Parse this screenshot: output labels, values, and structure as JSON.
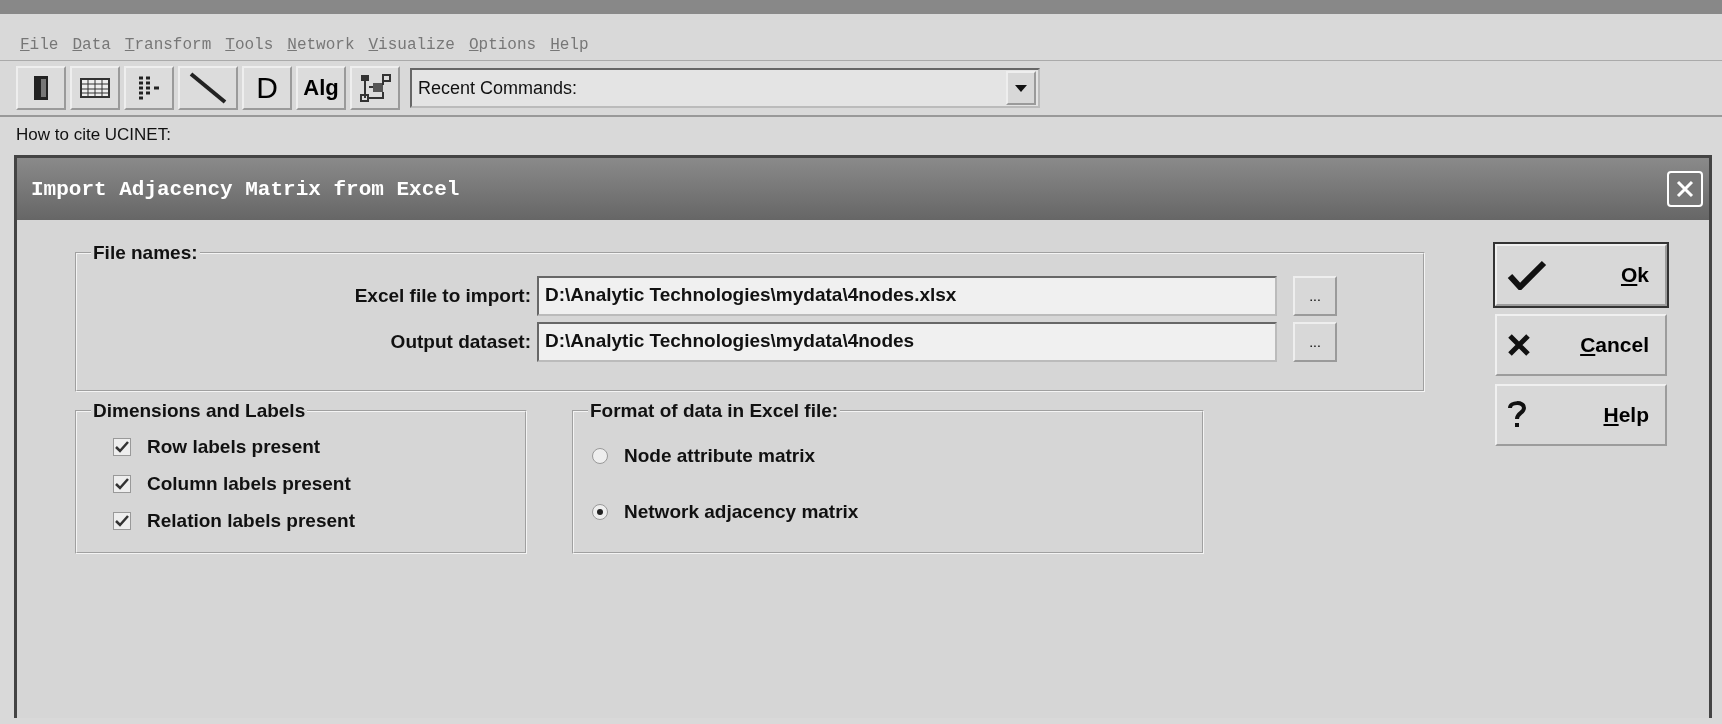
{
  "menu": [
    "File",
    "Data",
    "Transform",
    "Tools",
    "Network",
    "Visualize",
    "Options",
    "Help"
  ],
  "toolbar": {
    "buttons": [
      {
        "kind": "door"
      },
      {
        "kind": "grid"
      },
      {
        "kind": "list"
      },
      {
        "kind": "line"
      },
      {
        "kind": "text",
        "label": "D"
      },
      {
        "kind": "text",
        "label": "Alg"
      },
      {
        "kind": "tree"
      }
    ],
    "recent_commands": {
      "value": "Recent Commands:"
    }
  },
  "status": "How to cite UCINET:",
  "dialog": {
    "title": "Import Adjacency Matrix from Excel",
    "file_names": {
      "legend": "File names:",
      "fields": [
        {
          "label": "Excel file to import:",
          "value": "D:\\Analytic Technologies\\mydata\\4nodes.xlsx",
          "browse": "..."
        },
        {
          "label": "Output dataset:",
          "value": "D:\\Analytic Technologies\\mydata\\4nodes",
          "browse": "..."
        }
      ]
    },
    "dimensions": {
      "legend": "Dimensions and Labels",
      "checkboxes": [
        {
          "label": "Row labels present",
          "checked": true
        },
        {
          "label": "Column labels present",
          "checked": true
        },
        {
          "label": "Relation labels present",
          "checked": true
        }
      ]
    },
    "format": {
      "legend": "Format of data in Excel file:",
      "options": [
        {
          "label": "Node attribute matrix",
          "selected": false
        },
        {
          "label": "Network adjacency matrix",
          "selected": true
        }
      ]
    },
    "buttons": [
      {
        "kind": "ok",
        "label": "Ok"
      },
      {
        "kind": "cancel",
        "label": "Cancel"
      },
      {
        "kind": "help",
        "label": "Help"
      }
    ]
  }
}
